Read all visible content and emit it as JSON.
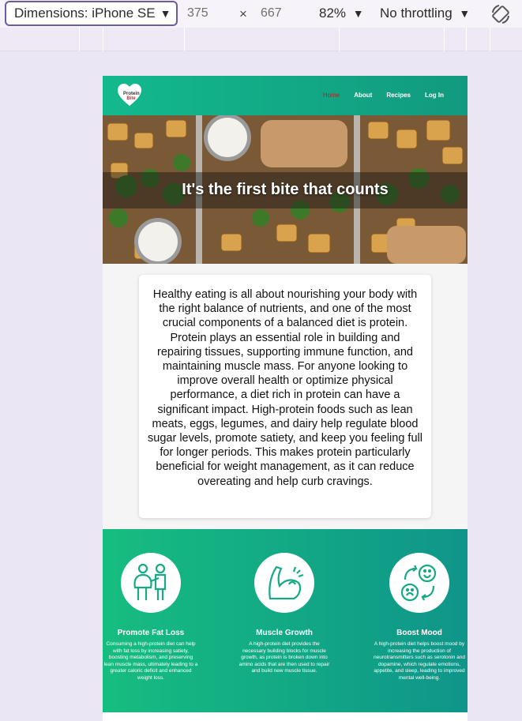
{
  "devtools": {
    "device": "Dimensions: iPhone SE",
    "width": "375",
    "times": "×",
    "height": "667",
    "zoom": "82%",
    "throttle": "No throttling",
    "accent": "#6b5aa5"
  },
  "site": {
    "logo": {
      "line1": "Protein",
      "line2": "Bite"
    },
    "nav": {
      "home": "Home",
      "about": "About",
      "recipes": "Recipes",
      "login": "Log In"
    },
    "hero_title": "It's the first bite that counts",
    "intro": "Healthy eating is all about nourishing your body with the right balance of nutrients, and one of the most crucial components of a balanced diet is protein. Protein plays an essential role in building and repairing tissues, supporting immune function, and maintaining muscle mass. For anyone looking to improve overall health or optimize physical performance, a diet rich in protein can have a significant impact. High-protein foods such as lean meats, eggs, legumes, and dairy help regulate blood sugar levels, promote satiety, and keep you feeling full for longer periods. This makes protein particularly beneficial for weight management, as it can reduce overeating and help curb cravings.",
    "features": [
      {
        "icon": "fat-loss-icon",
        "title": "Promote Fat Loss",
        "text": "Consuming a high-protein diet can help with fat loss by increasing satiety, boosting metabolism, and preserving lean muscle mass, ultimately leading to a greater caloric deficit and enhanced weight loss."
      },
      {
        "icon": "muscle-icon",
        "title": "Muscle Growth",
        "text": "A high-protein diet provides the necessary building blocks for muscle growth, as protein is broken down into amino acids that are then used to repair and build new muscle tissue."
      },
      {
        "icon": "mood-icon",
        "title": "Boost Mood",
        "text": "A high-protein diet helps boost mood by increasing the production of neurotransmitters such as serotonin and dopamine, which regulate emotions, appetite, and sleep, leading to improved mental well-being."
      }
    ],
    "colors": {
      "brand_green": "#13b98d",
      "active_link": "#b52027"
    }
  }
}
